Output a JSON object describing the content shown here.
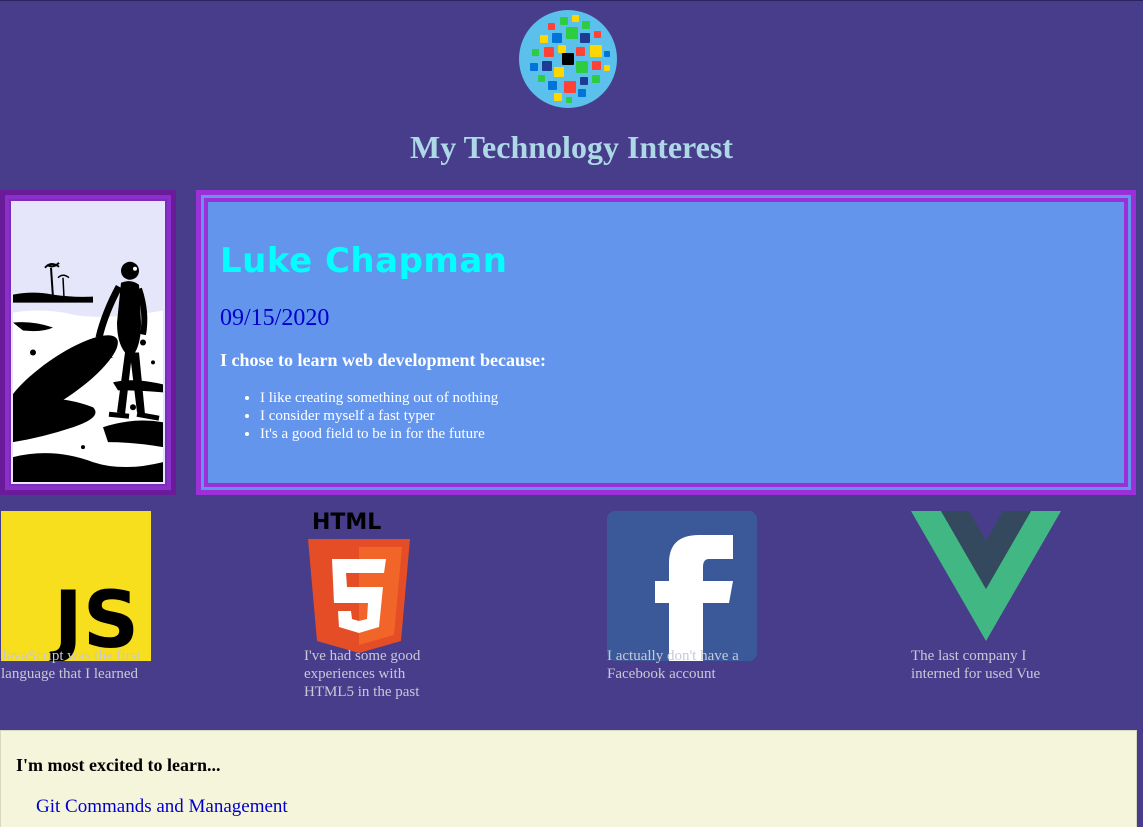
{
  "header": {
    "title": "My Technology Interest",
    "logo_icon": "mosaic-circle-logo-icon"
  },
  "profile": {
    "photo_icon": "surfer-photo",
    "name": "Luke Chapman",
    "date": "09/15/2020",
    "heading": "I chose to learn web development because:",
    "reasons": [
      "I like creating something out of nothing",
      "I consider myself a fast typer",
      "It's a good field to be in for the future"
    ]
  },
  "technologies": [
    {
      "icon": "javascript-icon",
      "caption": "JavaScript was the first language that I learned",
      "color": "#f7df1e"
    },
    {
      "icon": "html5-icon",
      "caption": "I've had some good experiences with HTML5 in the past",
      "color": "#e44d26"
    },
    {
      "icon": "facebook-icon",
      "caption": "I actually don't have a Facebook account",
      "color": "#3b5998"
    },
    {
      "icon": "vue-icon",
      "caption": "The last company I interned for used Vue",
      "color": "#41b883"
    }
  ],
  "learn": {
    "heading": "I'm most excited to learn...",
    "link": "Git Commands and Management"
  },
  "colors": {
    "background": "#483d8b",
    "title": "#add8e6",
    "bio_background": "#6495ed",
    "frame": "#9b30d9",
    "name": "#00ffff",
    "date": "#0000cd",
    "learn_background": "#f5f5dc"
  }
}
